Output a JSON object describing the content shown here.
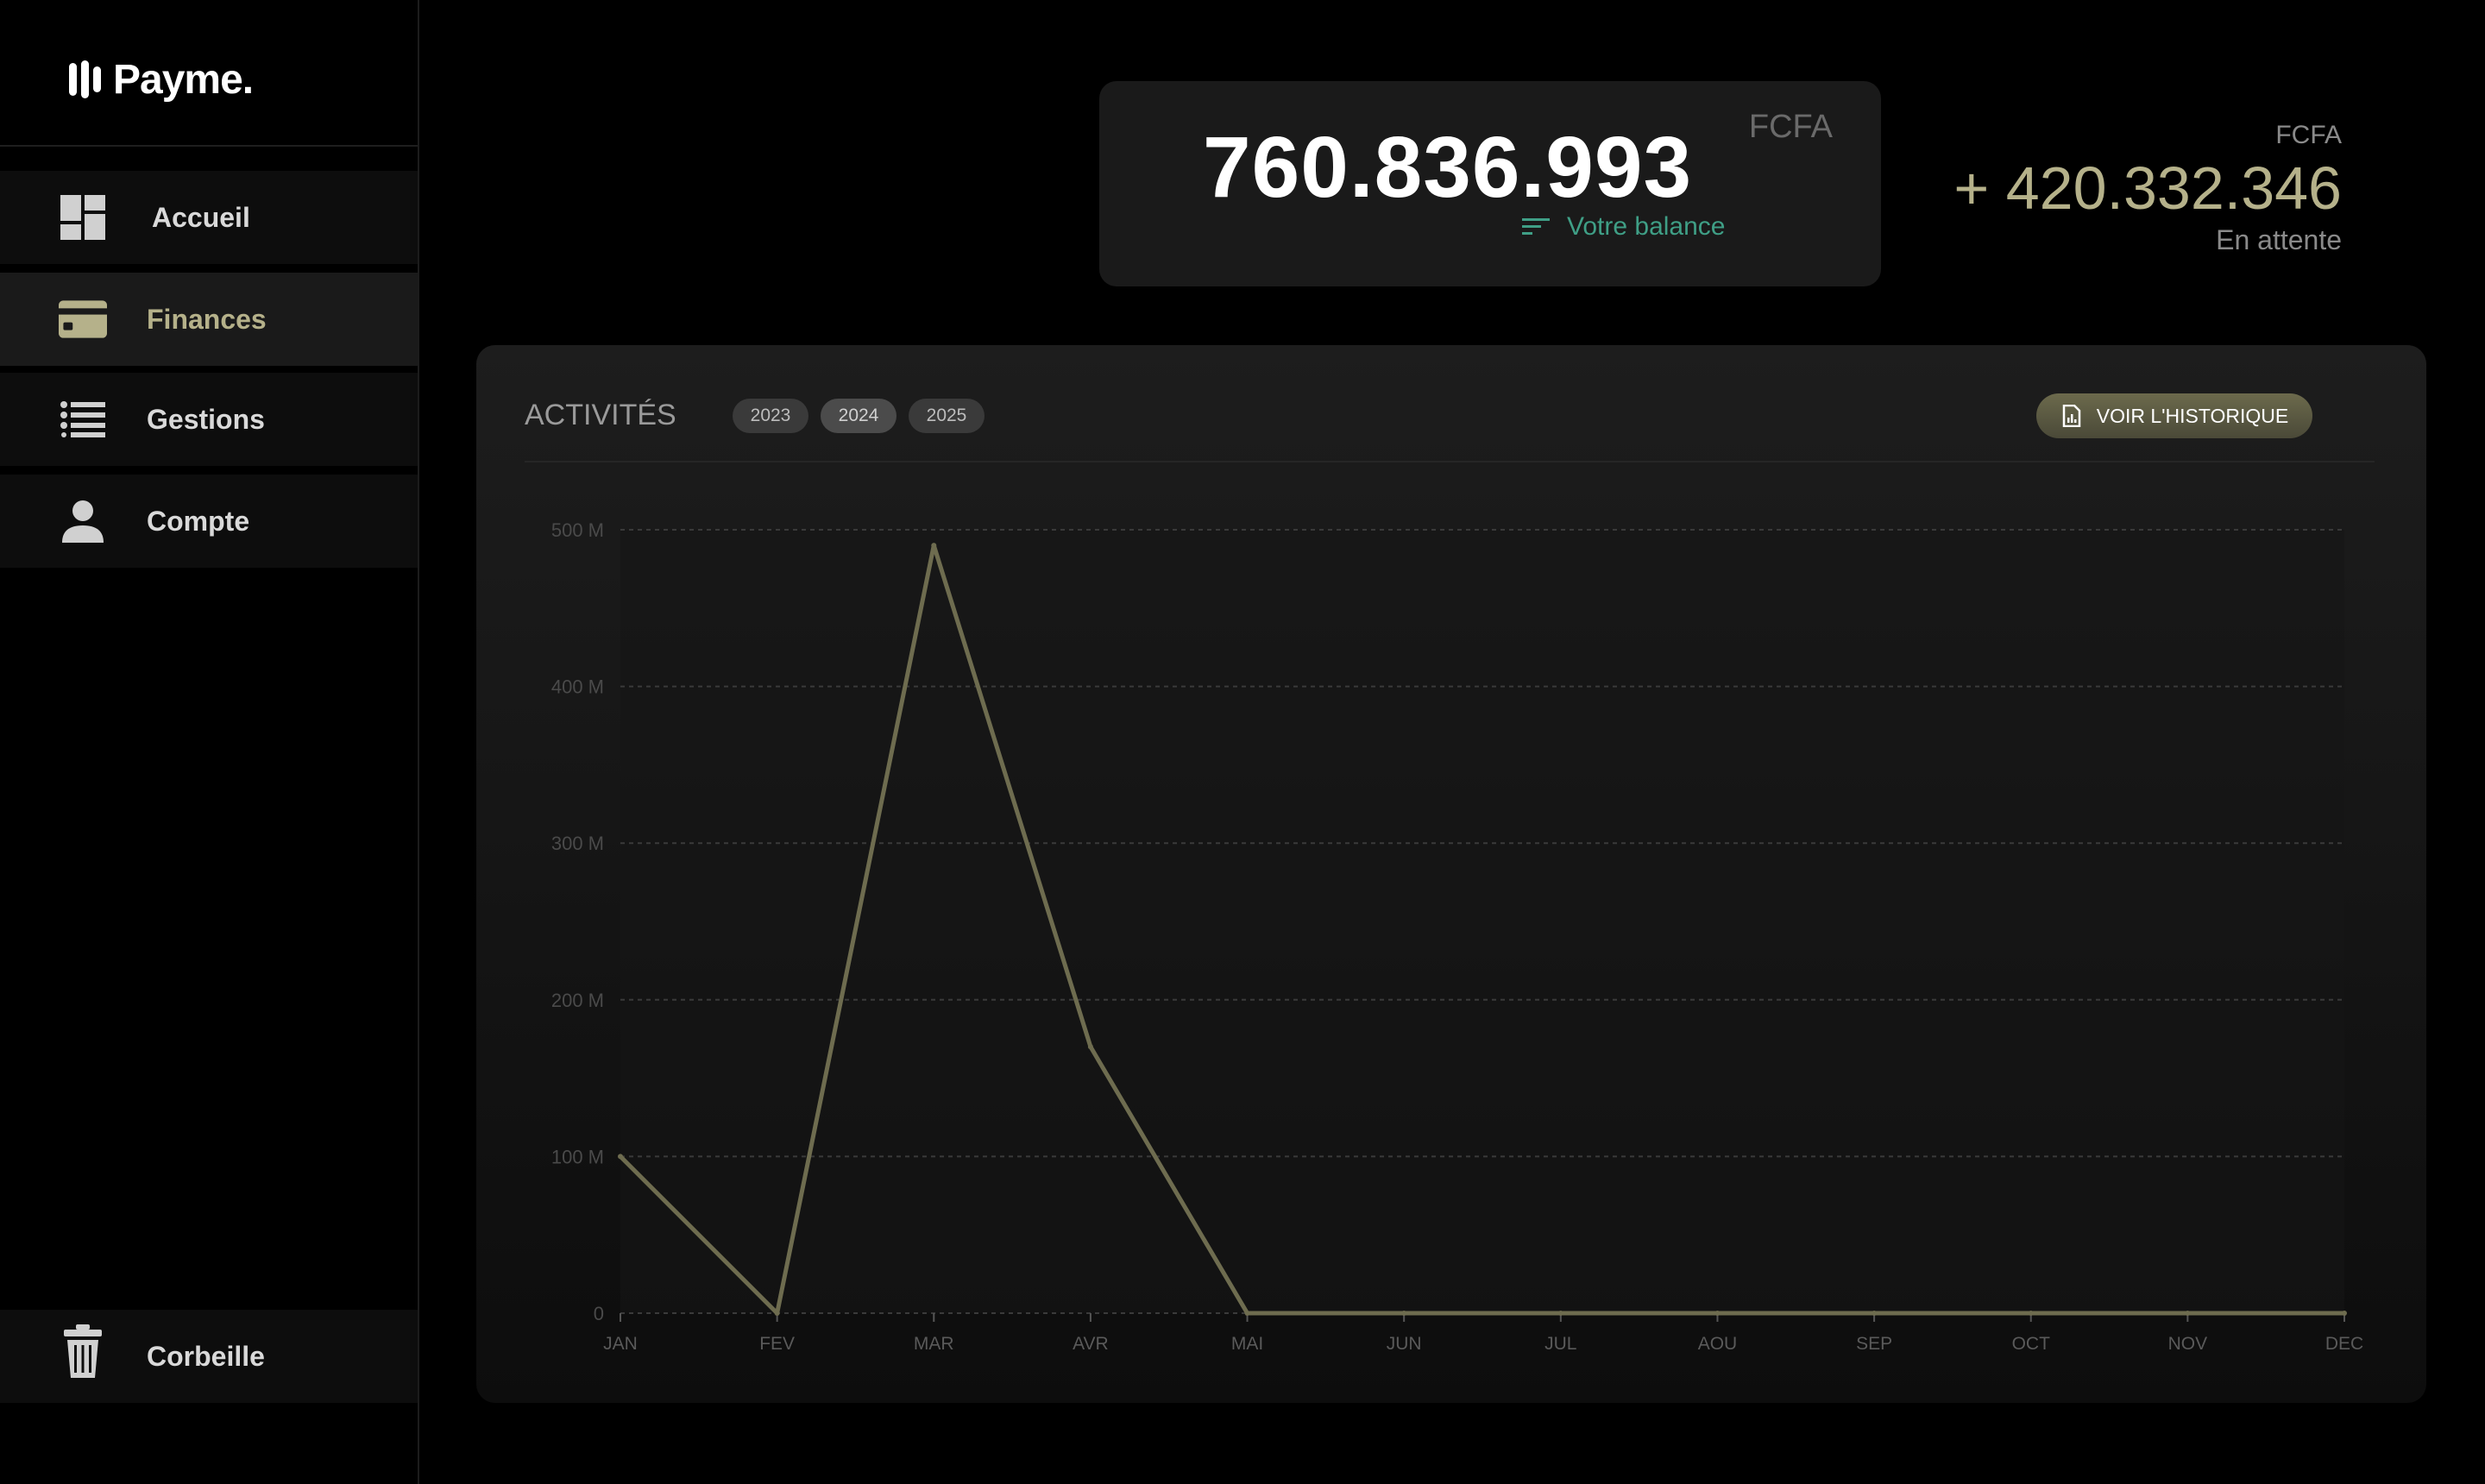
{
  "brand": {
    "name": "Payme."
  },
  "sidebar": {
    "items": [
      {
        "label": "Accueil",
        "icon": "dashboard-icon"
      },
      {
        "label": "Finances",
        "icon": "card-icon",
        "active": true
      },
      {
        "label": "Gestions",
        "icon": "list-icon"
      },
      {
        "label": "Compte",
        "icon": "user-icon"
      }
    ],
    "bottom": {
      "label": "Corbeille",
      "icon": "trash-icon"
    }
  },
  "balance": {
    "amount": "760.836.993",
    "currency": "FCFA",
    "label": "Votre balance"
  },
  "pending": {
    "currency": "FCFA",
    "amount": "+ 420.332.346",
    "label": "En attente"
  },
  "activities": {
    "title": "ACTIVITÉS",
    "years": [
      "2023",
      "2024",
      "2025"
    ],
    "selected_year": "2024",
    "history_button": "VOIR L'HISTORIQUE"
  },
  "colors": {
    "accent": "#b5b18a",
    "line": "#6e6c4f",
    "teal": "#3f9f86"
  },
  "chart_data": {
    "type": "line",
    "categories": [
      "JAN",
      "FEV",
      "MAR",
      "AVR",
      "MAI",
      "JUN",
      "JUL",
      "AOU",
      "SEP",
      "OCT",
      "NOV",
      "DEC"
    ],
    "values": [
      100,
      0,
      490,
      170,
      0,
      0,
      0,
      0,
      0,
      0,
      0,
      0
    ],
    "unit": "M",
    "yticks": [
      "0",
      "100 M",
      "200 M",
      "300 M",
      "400 M",
      "500 M"
    ],
    "ylim": [
      0,
      500
    ],
    "grid": true
  }
}
